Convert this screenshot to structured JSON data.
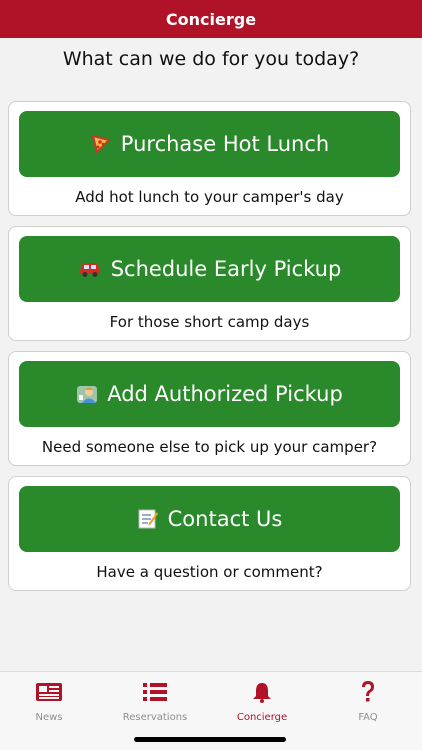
{
  "header": {
    "title": "Concierge"
  },
  "intro": "What can we do for you today?",
  "cards": [
    {
      "icon": "pizza-icon",
      "label": "Purchase Hot Lunch",
      "caption": "Add hot lunch to your camper's day"
    },
    {
      "icon": "car-icon",
      "label": "Schedule Early Pickup",
      "caption": "For those short camp days"
    },
    {
      "icon": "person-id-icon",
      "label": "Add Authorized Pickup",
      "caption": "Need someone else to pick up your camper?"
    },
    {
      "icon": "memo-icon",
      "label": "Contact Us",
      "caption": "Have a question or comment?"
    }
  ],
  "tabs": [
    {
      "icon": "newspaper-icon",
      "label": "News",
      "active": false
    },
    {
      "icon": "list-icon",
      "label": "Reservations",
      "active": false
    },
    {
      "icon": "bell-icon",
      "label": "Concierge",
      "active": true
    },
    {
      "icon": "question-icon",
      "label": "FAQ",
      "active": false
    }
  ],
  "colors": {
    "brand": "#b01227",
    "button": "#2a8a2b",
    "inactive_tab": "#8e8e93"
  }
}
